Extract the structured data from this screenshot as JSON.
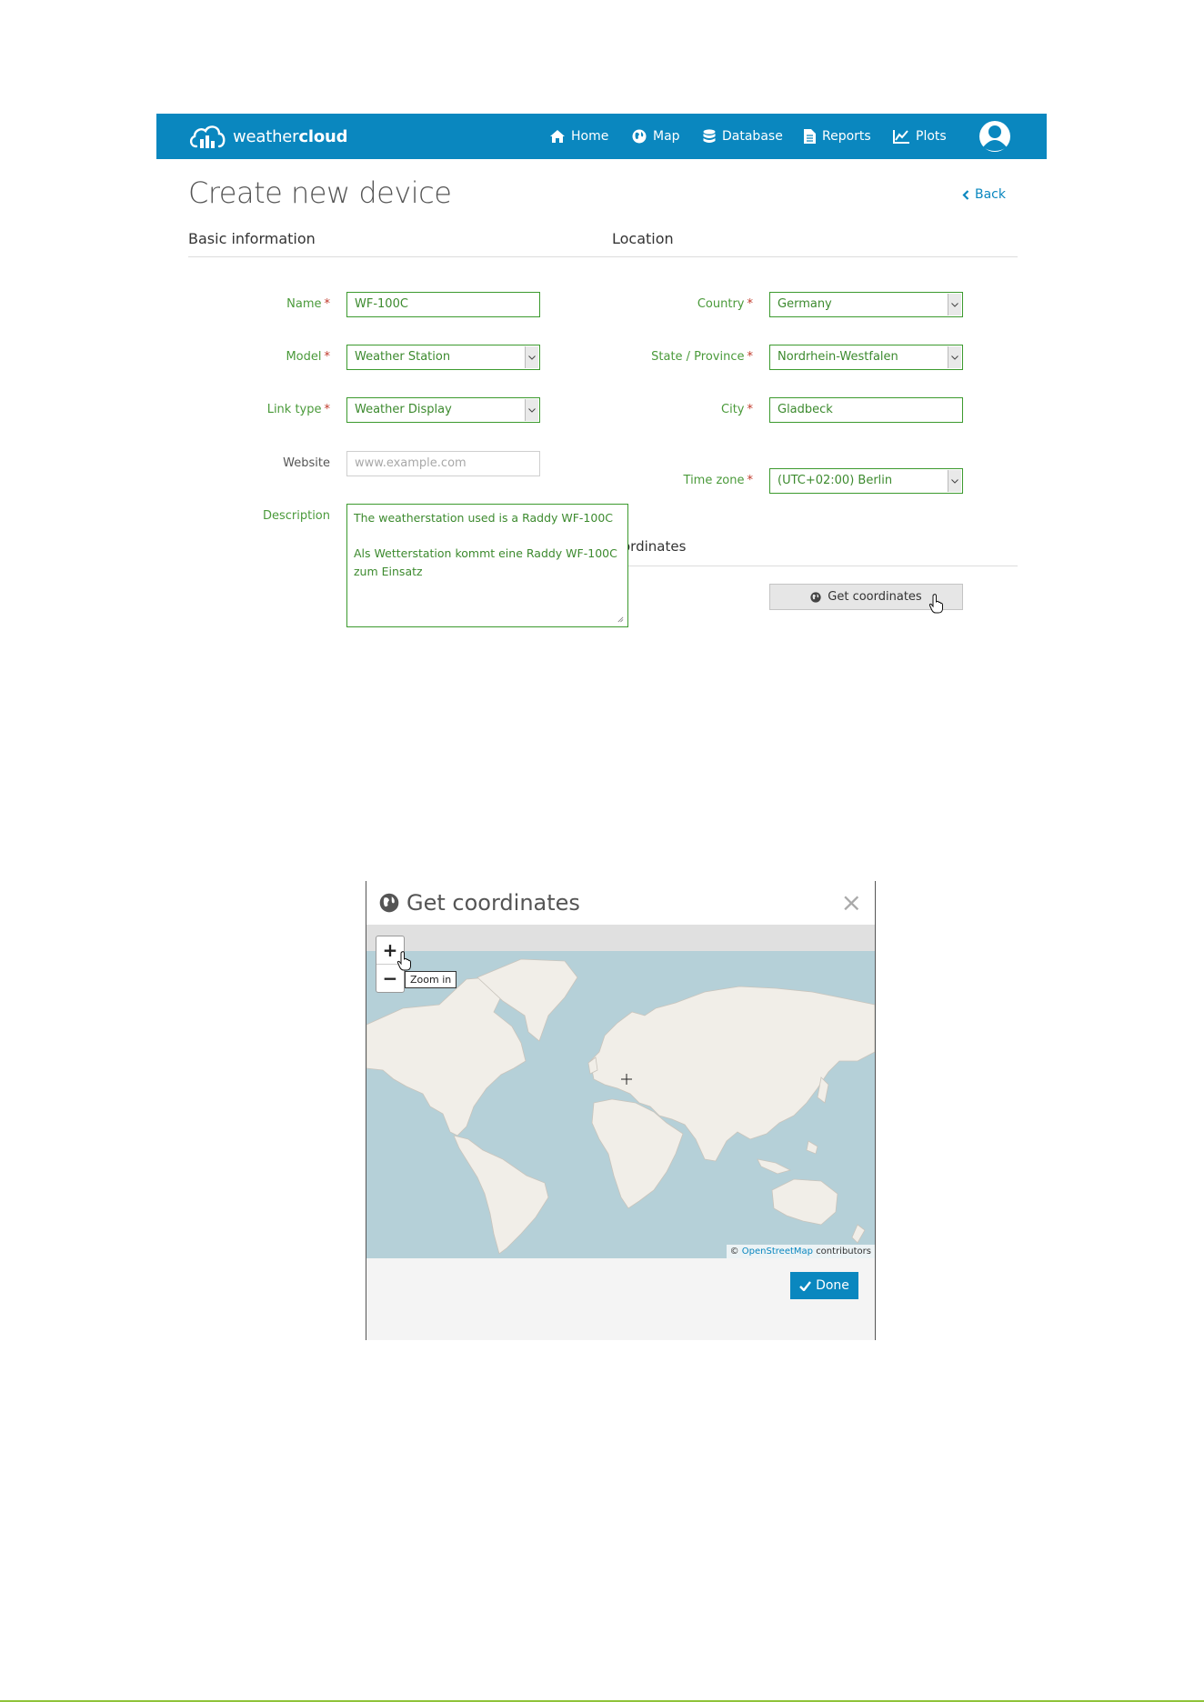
{
  "app": {
    "logo_text_light": "weather",
    "logo_text_bold": "cloud",
    "brand_color": "#0a87bf"
  },
  "nav": [
    {
      "label": "Home",
      "icon": "home-icon"
    },
    {
      "label": "Map",
      "icon": "globe-icon"
    },
    {
      "label": "Database",
      "icon": "database-icon"
    },
    {
      "label": "Reports",
      "icon": "document-icon"
    },
    {
      "label": "Plots",
      "icon": "chart-line-icon"
    }
  ],
  "page": {
    "title": "Create new device",
    "back_label": "Back"
  },
  "basic": {
    "heading": "Basic information",
    "name_label": "Name",
    "name_value": "WF-100C",
    "model_label": "Model",
    "model_value": "Weather Station",
    "link_label": "Link type",
    "link_value": "Weather Display",
    "website_label": "Website",
    "website_placeholder": "www.example.com",
    "description_label": "Description",
    "description_value": "The weatherstation used is a Raddy WF-100C\n\nAls Wetterstation kommt eine Raddy WF-100C\nzum Einsatz",
    "required_mark": "*"
  },
  "location": {
    "heading": "Location",
    "country_label": "Country",
    "country_value": "Germany",
    "state_label": "State / Province",
    "state_value": "Nordrhein-Westfalen",
    "city_label": "City",
    "city_value": "Gladbeck",
    "tz_label": "Time zone",
    "tz_value": "(UTC+02:00) Berlin",
    "coords_heading_partial": "ordinates",
    "get_coords_label": "Get coordinates"
  },
  "dialog": {
    "title": "Get coordinates",
    "close_glyph": "×",
    "zoom_in": "+",
    "zoom_out": "−",
    "zoom_tooltip": "Zoom in",
    "attribution_prefix": "©",
    "attribution_link": "OpenStreetMap",
    "attribution_suffix": "contributors",
    "done_label": "Done"
  }
}
